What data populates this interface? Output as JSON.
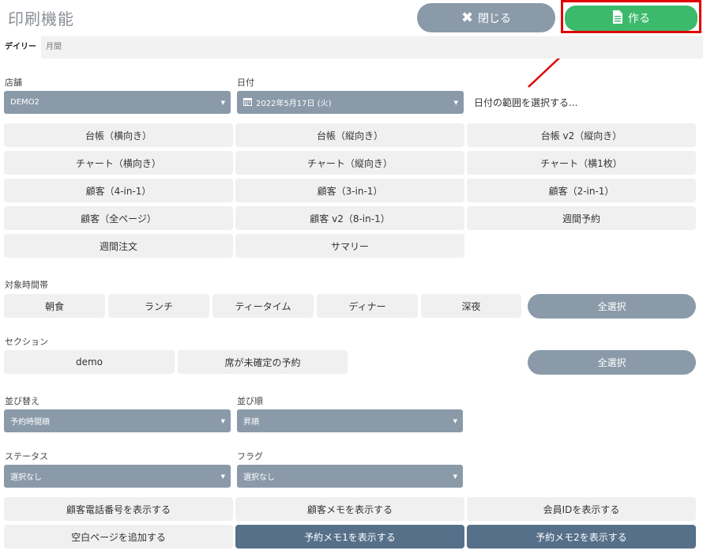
{
  "header": {
    "title": "印刷機能",
    "close_label": "閉じる",
    "create_label": "作る"
  },
  "tabs": {
    "daily": "デイリー",
    "monthly": "月間"
  },
  "store": {
    "label": "店舗",
    "value": "DEMO2"
  },
  "date": {
    "label": "日付",
    "value": "2022年5月17日 (火)",
    "range_link": "日付の範囲を選択する..."
  },
  "reports": [
    "台帳（横向き）",
    "台帳（縦向き）",
    "台帳 v2（縦向き）",
    "チャート（横向き）",
    "チャート（縦向き）",
    "チャート（横1枚）",
    "顧客（4-in-1）",
    "顧客（3-in-1）",
    "顧客（2-in-1）",
    "顧客（全ページ）",
    "顧客 v2（8-in-1）",
    "週間予約",
    "週間注文",
    "サマリー"
  ],
  "timeslots": {
    "label": "対象時間帯",
    "items": [
      "朝食",
      "ランチ",
      "ティータイム",
      "ディナー",
      "深夜"
    ],
    "select_all": "全選択"
  },
  "sections": {
    "label": "セクション",
    "items": [
      "demo",
      "席が未確定の予約"
    ],
    "select_all": "全選択"
  },
  "sort": {
    "label": "並び替え",
    "value": "予約時間順"
  },
  "order": {
    "label": "並び順",
    "value": "昇順"
  },
  "status": {
    "label": "ステータス",
    "value": "選択なし"
  },
  "flag": {
    "label": "フラグ",
    "value": "選択なし"
  },
  "options": {
    "show_phone": "顧客電話番号を表示する",
    "show_memo": "顧客メモを表示する",
    "show_member_id": "会員IDを表示する",
    "add_blank_page": "空白ページを追加する",
    "show_memo1": "予約メモ1を表示する",
    "show_memo2": "予約メモ2を表示する"
  },
  "colors": {
    "primary_gray": "#8a9aa9",
    "create_green": "#3cba6b",
    "dark_selected": "#56708a",
    "highlight_red": "#e00000"
  }
}
